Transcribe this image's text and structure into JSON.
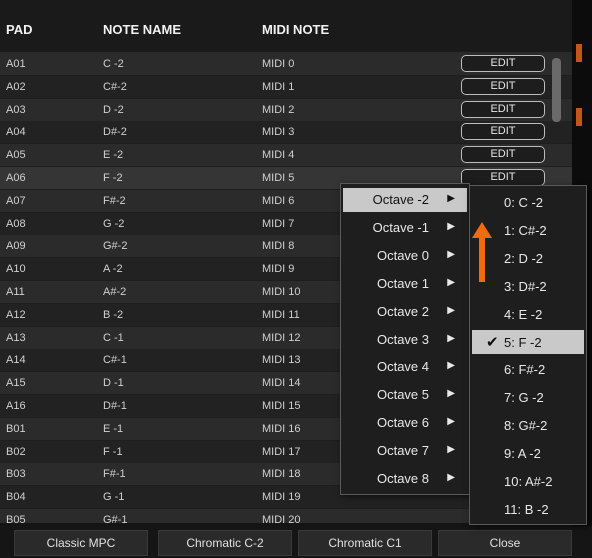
{
  "header": {
    "col_pad": "PAD",
    "col_note": "NOTE NAME",
    "col_midi": "MIDI NOTE"
  },
  "rows": [
    {
      "pad": "A01",
      "note": "C -2",
      "midi": "MIDI 0",
      "edit": "EDIT"
    },
    {
      "pad": "A02",
      "note": "C#-2",
      "midi": "MIDI 1",
      "edit": "EDIT"
    },
    {
      "pad": "A03",
      "note": "D -2",
      "midi": "MIDI 2",
      "edit": "EDIT"
    },
    {
      "pad": "A04",
      "note": "D#-2",
      "midi": "MIDI 3",
      "edit": "EDIT"
    },
    {
      "pad": "A05",
      "note": "E -2",
      "midi": "MIDI 4",
      "edit": "EDIT"
    },
    {
      "pad": "A06",
      "note": "F -2",
      "midi": "MIDI 5",
      "edit": "EDIT"
    },
    {
      "pad": "A07",
      "note": "F#-2",
      "midi": "MIDI 6",
      "edit": ""
    },
    {
      "pad": "A08",
      "note": "G -2",
      "midi": "MIDI 7",
      "edit": ""
    },
    {
      "pad": "A09",
      "note": "G#-2",
      "midi": "MIDI 8",
      "edit": ""
    },
    {
      "pad": "A10",
      "note": "A -2",
      "midi": "MIDI 9",
      "edit": ""
    },
    {
      "pad": "A11",
      "note": "A#-2",
      "midi": "MIDI 10",
      "edit": ""
    },
    {
      "pad": "A12",
      "note": "B -2",
      "midi": "MIDI 11",
      "edit": ""
    },
    {
      "pad": "A13",
      "note": "C -1",
      "midi": "MIDI 12",
      "edit": ""
    },
    {
      "pad": "A14",
      "note": "C#-1",
      "midi": "MIDI 13",
      "edit": ""
    },
    {
      "pad": "A15",
      "note": "D -1",
      "midi": "MIDI 14",
      "edit": ""
    },
    {
      "pad": "A16",
      "note": "D#-1",
      "midi": "MIDI 15",
      "edit": ""
    },
    {
      "pad": "B01",
      "note": "E -1",
      "midi": "MIDI 16",
      "edit": ""
    },
    {
      "pad": "B02",
      "note": "F -1",
      "midi": "MIDI 17",
      "edit": ""
    },
    {
      "pad": "B03",
      "note": "F#-1",
      "midi": "MIDI 18",
      "edit": ""
    },
    {
      "pad": "B04",
      "note": "G -1",
      "midi": "MIDI 19",
      "edit": ""
    },
    {
      "pad": "B05",
      "note": "G#-1",
      "midi": "MIDI 20",
      "edit": ""
    }
  ],
  "octave_menu": {
    "items": [
      "Octave -2",
      "Octave -1",
      "Octave 0",
      "Octave 1",
      "Octave 2",
      "Octave 3",
      "Octave 4",
      "Octave 5",
      "Octave 6",
      "Octave 7",
      "Octave 8"
    ],
    "active_index": 0,
    "arrow_glyph": "▶"
  },
  "note_menu": {
    "items": [
      "0: C -2",
      "1: C#-2",
      "2: D -2",
      "3: D#-2",
      "4: E -2",
      "5: F -2",
      "6: F#-2",
      "7: G -2",
      "8: G#-2",
      "9: A -2",
      "10: A#-2",
      "11: B -2"
    ],
    "checked_index": 5,
    "check_glyph": "✔"
  },
  "footer": {
    "classic": "Classic MPC",
    "chromatic_c2": "Chromatic C-2",
    "chromatic_c1": "Chromatic C1",
    "close": "Close"
  },
  "colors": {
    "accent_orange": "#f26a10",
    "menu_highlight": "#c9c9c9"
  },
  "icons": {
    "submenu": "chevron-right-icon",
    "check": "checkmark-icon",
    "annotation": "up-arrow-icon"
  }
}
